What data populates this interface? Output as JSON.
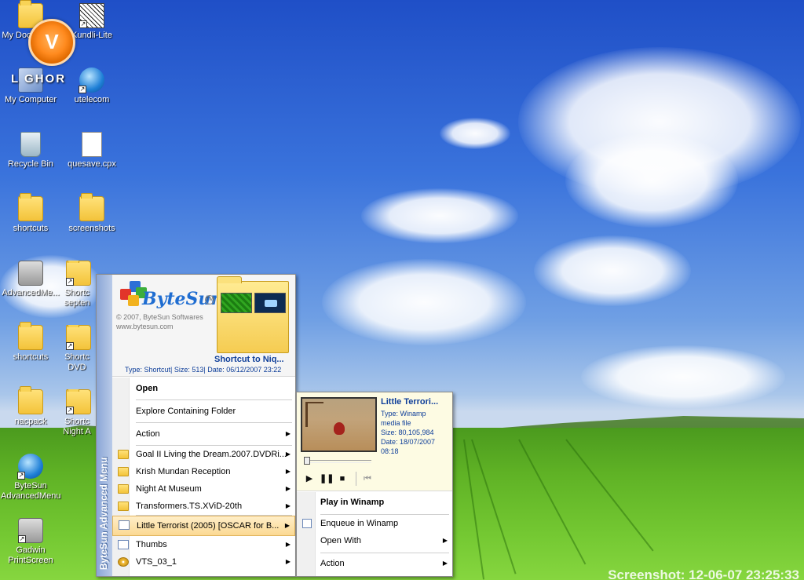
{
  "desktop": {
    "icons": [
      {
        "label": "My Documents"
      },
      {
        "label": "Kundli-Lite"
      },
      {
        "label": "My Computer"
      },
      {
        "label": "utelecom"
      },
      {
        "label": "Recycle Bin"
      },
      {
        "label": "quesave.cpx"
      },
      {
        "label": "shortcuts"
      },
      {
        "label": "screenshots"
      },
      {
        "label": "AdvancedMe..."
      },
      {
        "label": "Shortc septen"
      },
      {
        "label": "shortcuts"
      },
      {
        "label": "Shortc DVD"
      },
      {
        "label": "nacpack"
      },
      {
        "label": "Shortc Night A"
      },
      {
        "label": "ByteSun AdvancedMenu"
      },
      {
        "label": "Gadwin PrintScreen"
      }
    ],
    "logo_letter": "V",
    "ghost_word": "L  GHOR"
  },
  "menu": {
    "side_title": "ByteSun Advanced Menu",
    "header": {
      "logo_text": "ByteSun",
      "tm": "TM",
      "copyright_line1": "© 2007, ByteSun Softwares",
      "copyright_line2": "www.bytesun.com",
      "title": "Shortcut to Niq...",
      "info": "Type: Shortcut| Size: 513| Date: 06/12/2007 23:22"
    },
    "items": [
      {
        "label": "Open"
      },
      {
        "label": "Explore Containing Folder"
      },
      {
        "label": "Action"
      },
      {
        "label": "Goal II Living the Dream.2007.DVDRi..."
      },
      {
        "label": "Krish Mundan Reception"
      },
      {
        "label": "Night At Museum"
      },
      {
        "label": "Transformers.TS.XViD-20th"
      },
      {
        "label": "Little Terrorist (2005) [OSCAR for  B..."
      },
      {
        "label": "Thumbs"
      },
      {
        "label": "VTS_03_1"
      }
    ]
  },
  "submenu": {
    "title": "Little Terrori...",
    "type_line1": "Type: Winamp",
    "type_line2": "media file",
    "size": "Size: 80,105,984",
    "date_line1": "Date: 18/07/2007",
    "date_line2": "08:18",
    "items": [
      {
        "label": "Play in Winamp"
      },
      {
        "label": "Enqueue in Winamp"
      },
      {
        "label": "Open With"
      },
      {
        "label": "Action"
      }
    ]
  },
  "watermark": "Screenshot: 12-06-07 23:25:33"
}
